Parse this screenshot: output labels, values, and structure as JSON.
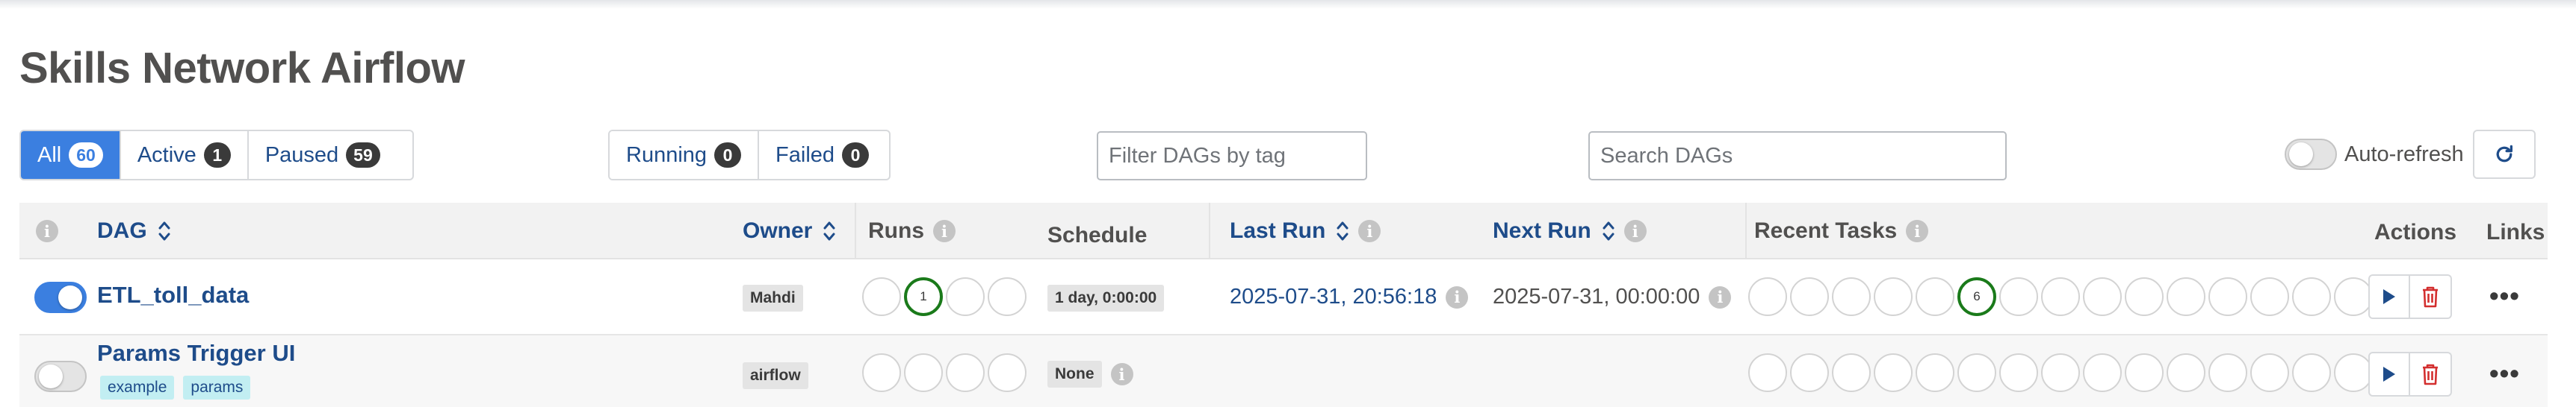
{
  "page_title": "Skills Network Airflow",
  "status_filters": [
    {
      "label": "All",
      "count": "60",
      "active": true
    },
    {
      "label": "Active",
      "count": "1",
      "active": false
    },
    {
      "label": "Paused",
      "count": "59",
      "active": false
    }
  ],
  "run_filters": [
    {
      "label": "Running",
      "count": "0"
    },
    {
      "label": "Failed",
      "count": "0"
    }
  ],
  "tag_filter": {
    "placeholder": "Filter DAGs by tag"
  },
  "search": {
    "placeholder": "Search DAGs"
  },
  "auto_refresh": {
    "label": "Auto-refresh",
    "enabled": false
  },
  "table": {
    "columns": {
      "dag": "DAG",
      "owner": "Owner",
      "runs": "Runs",
      "schedule": "Schedule",
      "last_run": "Last Run",
      "next_run": "Next Run",
      "recent_tasks": "Recent Tasks",
      "actions": "Actions",
      "links": "Links"
    },
    "rows": [
      {
        "enabled": true,
        "dag_id": "ETL_toll_data",
        "tags": [],
        "owner": "Mahdi",
        "runs": [
          "",
          "1",
          "",
          ""
        ],
        "schedule": "1 day, 0:00:00",
        "last_run": "2025-07-31, 20:56:18",
        "next_run": "2025-07-31, 00:00:00",
        "recent_tasks": [
          "",
          "",
          "",
          "",
          "",
          "6",
          "",
          "",
          "",
          "",
          "",
          "",
          "",
          "",
          ""
        ]
      },
      {
        "enabled": false,
        "dag_id": "Params Trigger UI",
        "tags": [
          "example",
          "params"
        ],
        "owner": "airflow",
        "runs": [
          "",
          "",
          "",
          ""
        ],
        "schedule": "None",
        "last_run": "",
        "next_run": "",
        "recent_tasks": [
          "",
          "",
          "",
          "",
          "",
          "",
          "",
          "",
          "",
          "",
          "",
          "",
          "",
          "",
          ""
        ]
      }
    ]
  },
  "colors": {
    "accent": "#3b7fe0",
    "link": "#1e4c8a",
    "success": "#1a7a1a",
    "delete": "#d32f2f",
    "tag_bg": "#c2eef2"
  },
  "icons": {
    "sort": "sort-icon",
    "info": "info-icon",
    "trigger": "play-icon",
    "delete": "trash-icon",
    "links": "more-horizontal-icon",
    "refresh": "refresh-icon"
  }
}
